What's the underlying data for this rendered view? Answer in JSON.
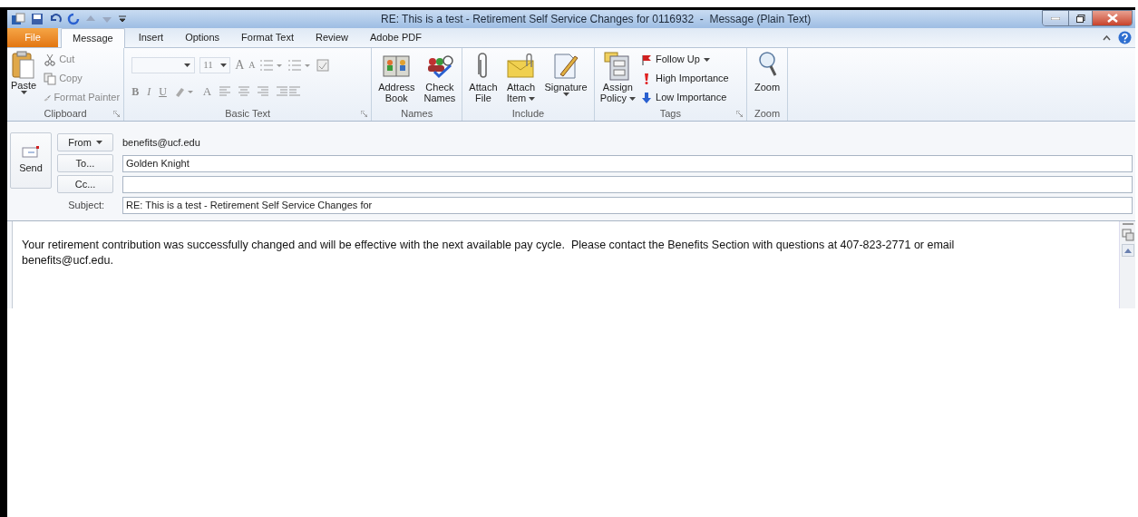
{
  "window": {
    "title": "RE: This is a test - Retirement Self Service Changes for 0116932  -  Message (Plain Text)"
  },
  "tabs": [
    {
      "label": "File",
      "kind": "file",
      "selected": false
    },
    {
      "label": "Message",
      "kind": "tab",
      "selected": true
    },
    {
      "label": "Insert",
      "kind": "tab",
      "selected": false
    },
    {
      "label": "Options",
      "kind": "tab",
      "selected": false
    },
    {
      "label": "Format Text",
      "kind": "tab",
      "selected": false
    },
    {
      "label": "Review",
      "kind": "tab",
      "selected": false
    },
    {
      "label": "Adobe PDF",
      "kind": "tab",
      "selected": false
    }
  ],
  "ribbon": {
    "clipboard": {
      "label": "Clipboard",
      "paste": "Paste",
      "small": [
        {
          "label": "Cut",
          "kind": "cut"
        },
        {
          "label": "Copy",
          "kind": "copy"
        },
        {
          "label": "Format Painter",
          "kind": "painter"
        }
      ]
    },
    "basic_text": {
      "label": "Basic Text",
      "font_size": "11",
      "grow": "A",
      "shrink": "A",
      "styles": [
        "B",
        "I",
        "U"
      ],
      "font_color": "A"
    },
    "names": {
      "label": "Names",
      "buttons": [
        {
          "lines": [
            "Address",
            "Book"
          ],
          "kind": "book",
          "dropdown": false
        },
        {
          "lines": [
            "Check",
            "Names"
          ],
          "kind": "check",
          "dropdown": false
        }
      ]
    },
    "include": {
      "label": "Include",
      "buttons": [
        {
          "lines": [
            "Attach",
            "File"
          ],
          "kind": "clip",
          "dropdown": false
        },
        {
          "lines": [
            "Attach",
            "Item"
          ],
          "kind": "envelope",
          "dropdown": true
        },
        {
          "lines": [
            "Signature"
          ],
          "kind": "signature",
          "dropdown": true
        }
      ]
    },
    "tags": {
      "label": "Tags",
      "assign": {
        "lines": [
          "Assign",
          "Policy"
        ],
        "dropdown": true
      },
      "small": [
        {
          "label": "Follow Up",
          "kind": "flag",
          "dropdown": true
        },
        {
          "label": "High Importance",
          "kind": "high",
          "dropdown": false
        },
        {
          "label": "Low Importance",
          "kind": "low",
          "dropdown": false
        }
      ]
    },
    "zoom": {
      "label": "Zoom",
      "button": "Zoom"
    }
  },
  "header": {
    "send": "Send",
    "from_button": "From",
    "from_value": "benefits@ucf.edu",
    "to_button": "To...",
    "to_value": "Golden Knight",
    "cc_button": "Cc...",
    "subject_label": "Subject:",
    "subject_value": "RE: This is a test - Retirement Self Service Changes for"
  },
  "body": {
    "lines": [
      "Your retirement contribution was successfully changed and will be effective with the next available pay cycle.  Please contact the Benefits Section with questions at 407-823-2771 or email",
      "benefits@ucf.edu."
    ]
  }
}
